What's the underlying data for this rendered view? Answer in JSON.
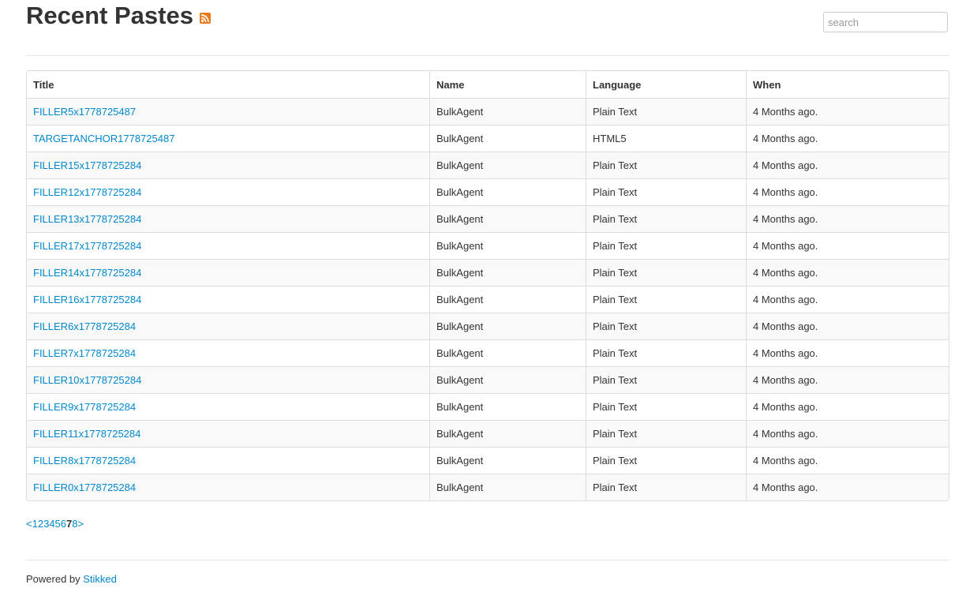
{
  "page": {
    "title": "Recent Pastes",
    "rss_icon": "rss-feed-icon"
  },
  "search": {
    "placeholder": "search",
    "value": ""
  },
  "table": {
    "headers": {
      "title": "Title",
      "name": "Name",
      "language": "Language",
      "when": "When"
    },
    "rows": [
      {
        "title": "FILLER5x1778725487",
        "name": "BulkAgent",
        "language": "Plain Text",
        "when": "4 Months ago."
      },
      {
        "title": "TARGETANCHOR1778725487",
        "name": "BulkAgent",
        "language": "HTML5",
        "when": "4 Months ago."
      },
      {
        "title": "FILLER15x1778725284",
        "name": "BulkAgent",
        "language": "Plain Text",
        "when": "4 Months ago."
      },
      {
        "title": "FILLER12x1778725284",
        "name": "BulkAgent",
        "language": "Plain Text",
        "when": "4 Months ago."
      },
      {
        "title": "FILLER13x1778725284",
        "name": "BulkAgent",
        "language": "Plain Text",
        "when": "4 Months ago."
      },
      {
        "title": "FILLER17x1778725284",
        "name": "BulkAgent",
        "language": "Plain Text",
        "when": "4 Months ago."
      },
      {
        "title": "FILLER14x1778725284",
        "name": "BulkAgent",
        "language": "Plain Text",
        "when": "4 Months ago."
      },
      {
        "title": "FILLER16x1778725284",
        "name": "BulkAgent",
        "language": "Plain Text",
        "when": "4 Months ago."
      },
      {
        "title": "FILLER6x1778725284",
        "name": "BulkAgent",
        "language": "Plain Text",
        "when": "4 Months ago."
      },
      {
        "title": "FILLER7x1778725284",
        "name": "BulkAgent",
        "language": "Plain Text",
        "when": "4 Months ago."
      },
      {
        "title": "FILLER10x1778725284",
        "name": "BulkAgent",
        "language": "Plain Text",
        "when": "4 Months ago."
      },
      {
        "title": "FILLER9x1778725284",
        "name": "BulkAgent",
        "language": "Plain Text",
        "when": "4 Months ago."
      },
      {
        "title": "FILLER11x1778725284",
        "name": "BulkAgent",
        "language": "Plain Text",
        "when": "4 Months ago."
      },
      {
        "title": "FILLER8x1778725284",
        "name": "BulkAgent",
        "language": "Plain Text",
        "when": "4 Months ago."
      },
      {
        "title": "FILLER0x1778725284",
        "name": "BulkAgent",
        "language": "Plain Text",
        "when": "4 Months ago."
      }
    ]
  },
  "pagination": {
    "prev": "<",
    "pages": [
      "1",
      "2",
      "3",
      "4",
      "5",
      "6",
      "7",
      "8"
    ],
    "current": "7",
    "next": ">"
  },
  "footer": {
    "prefix": "Powered by ",
    "link": "Stikked"
  },
  "colors": {
    "link": "#0088cc",
    "rss": "#e87a1d",
    "stripe": "#f9f9f9",
    "border": "#dddddd"
  }
}
